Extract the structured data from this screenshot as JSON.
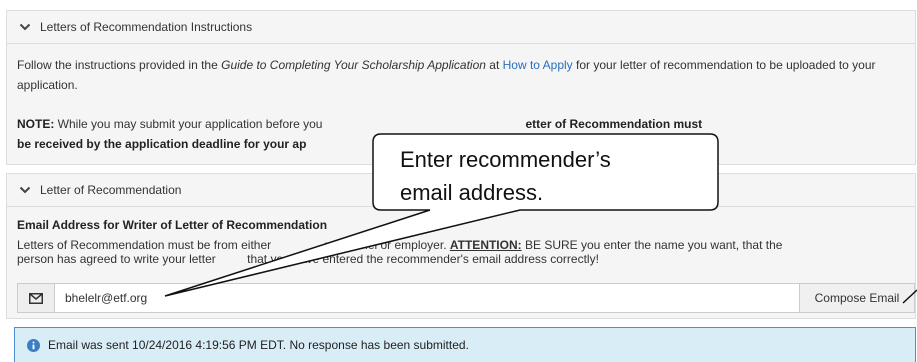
{
  "instructions_panel": {
    "title": "Letters of Recommendation Instructions",
    "para1_prefix": "Follow the instructions provided in the ",
    "guide_title": "Guide to Completing Your Scholarship Application",
    "para1_mid": " at ",
    "how_to_apply_link": "How to Apply",
    "para1_suffix": " for your letter of recommendation to be uploaded to your application.",
    "note_label": "NOTE:",
    "note_text_start": " While you may submit your application before you",
    "note_bold_end": "etter of Recommendation must",
    "note_line2_bold": "be received by the application deadline for your ap"
  },
  "recommendation_panel": {
    "title": "Letter of Recommendation",
    "email_label": "Email Address for Writer of Letter of Recommendation",
    "help_part1": "Letters of Recommendation must be from either",
    "help_part2": " personnel or employer. ",
    "attention_label": "ATTENTION:",
    "help_part3": " BE SURE you enter the name you want, that the",
    "help_line2_start": "person has agreed to write your letter",
    "help_line2_end": " that you have entered the recommender's email address correctly!",
    "email_value": "bhelelr@etf.org",
    "compose_button": "Compose Email"
  },
  "alert": {
    "text": "Email was sent 10/24/2016 4:19:56 PM EDT. No response has been submitted."
  },
  "callout": {
    "line1": "Enter recommender’s",
    "line2": "email address."
  },
  "colors": {
    "link": "#2a6ebb",
    "alert_bg": "#d9edf7",
    "alert_border": "#4f8fd6"
  }
}
